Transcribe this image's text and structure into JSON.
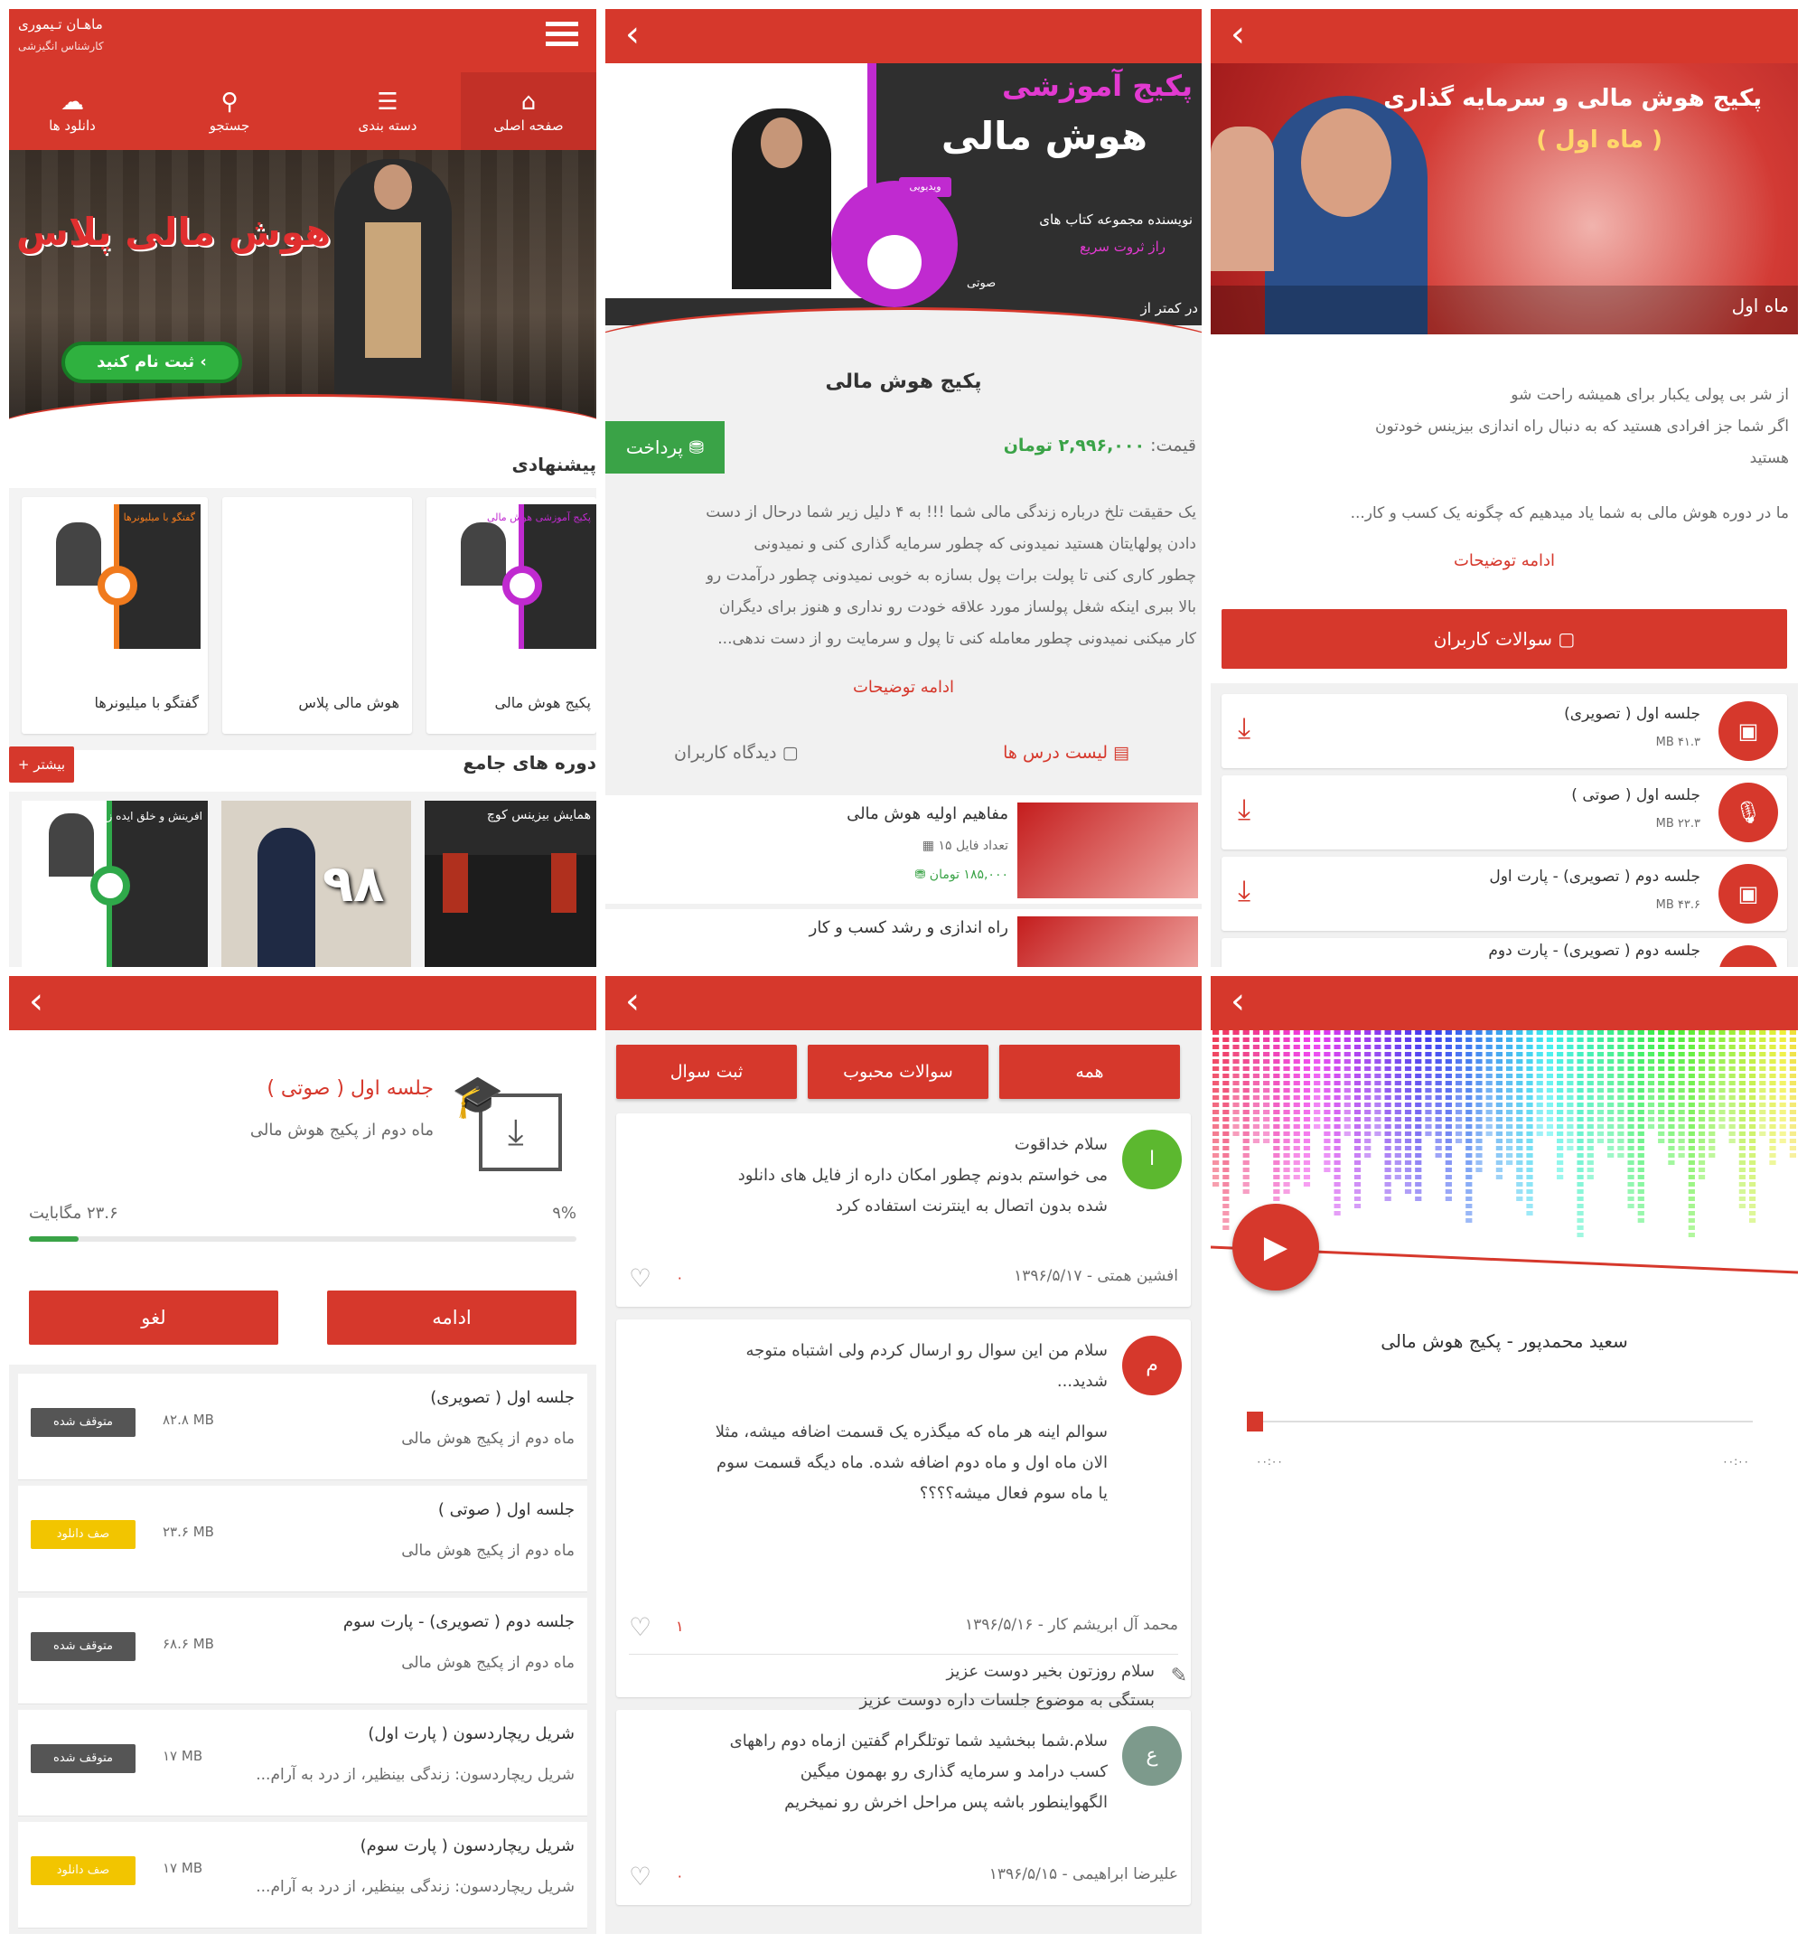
{
  "app": {
    "brand_title": "ماهـان تـیموری",
    "brand_subtitle": "کارشناس انگیزشی",
    "nav": [
      {
        "label": "صفحه اصلی",
        "icon": "home-icon"
      },
      {
        "label": "دسته بندی",
        "icon": "list-icon"
      },
      {
        "label": "جستجو",
        "icon": "search-icon"
      },
      {
        "label": "دانلود ها",
        "icon": "cloud-download-icon"
      }
    ],
    "hero_text": "هوش مالی پلاس",
    "hero_button": "ثبت نام کنید",
    "suggested_title": "پیشنهادی",
    "suggested": [
      {
        "label": "پکیج هوش مالی"
      },
      {
        "label": "هوش مالی پلاس"
      },
      {
        "label": "گفتگو با میلیونرها"
      }
    ],
    "thumb_text_1": "پکیج آموزشی هوش مالی",
    "thumb_text_2": "گفتگو با میلیونرها",
    "thumb_text_3": "همایش بیزینس کوچ",
    "thumb_text_4": "۹۸",
    "thumb_text_5": "افرینش و خلق ایده زیبا",
    "full_courses_title": "دوره های جامع",
    "more_label": "بیشتر"
  },
  "detail": {
    "banner_line1": "پکیج آموزشی",
    "banner_line2": "هوش مالی",
    "banner_line3": "نویسنده مجموعه کتاب های",
    "banner_line4": "راز ثروت سریع",
    "banner_tag": "صوتی",
    "banner_tag2": "ویدیویی",
    "banner_bottom": "در کمتر از",
    "title": "پکیج هوش مالی",
    "price_label": "قیمت:",
    "price_value": "۲,۹۹۶,۰۰۰ تومان",
    "pay_button": "پرداخت",
    "description": [
      "یک حقیقت تلخ درباره زندگی مالی شما !!! به ۴ دلیل زیر شما درحال از دست",
      "دادن پولهایتان هستید نمیدونی که چطور سرمایه گذاری کنی و نمیدونی",
      "چطور کاری کنی تا پولت برات پول بسازه به خوبی نمیدونی چطور درآمدت رو",
      "بالا ببری اینکه شغل پولساز مورد علاقه خودت رو نداری و هنوز برای دیگران",
      "کار میکنی نمیدونی چطور معامله کنی تا پول و سرمایت رو از دست ندهی..."
    ],
    "more_link": "ادامه توضیحات",
    "tab_lessons": "لیست درس ها",
    "tab_reviews": "دیدگاه کاربران",
    "lessons": [
      {
        "title": "مفاهیم اولیه هوش مالی",
        "files": "تعداد فایل ۱۵",
        "price": "۱۸۵,۰۰۰ تومان"
      },
      {
        "title": "راه اندازی و رشد کسب و کار",
        "files": "",
        "price": ""
      }
    ]
  },
  "month": {
    "banner_title": "پکیج هوش مالی و سرمایه گذاری",
    "banner_sub": "( ماه اول )",
    "banner_footer": "ماه اول",
    "desc": [
      "از شر بی پولی یکبار برای همیشه راحت شو",
      "اگر شما جز افرادی هستید که به دنبال راه اندازی بیزینس خودتون",
      "هستید",
      "ما در دوره هوش مالی به شما یاد میدهیم که چگونه یک کسب و کار..."
    ],
    "more_link": "ادامه توضیحات",
    "questions_button": "سوالات کاربران",
    "files": [
      {
        "title": "جلسه اول ( تصویری)",
        "size": "۴۱.۳ MB",
        "icon": "video-icon"
      },
      {
        "title": "جلسه اول ( صوتی )",
        "size": "۲۲.۳ MB",
        "icon": "microphone-icon"
      },
      {
        "title": "جلسه دوم ( تصویری) - پارت اول",
        "size": "۴۳.۶ MB",
        "icon": "video-icon"
      },
      {
        "title": "جلسه دوم ( تصویری) - پارت دوم",
        "size": "",
        "icon": "video-icon"
      }
    ]
  },
  "downloads": {
    "current_title": "جلسه اول ( صوتی )",
    "current_sub": "ماه دوم از پکیج هوش مالی",
    "current_size": "۲۳.۶ مگابایت",
    "current_percent": "۹%",
    "current_progress": 0.09,
    "continue_button": "ادامه",
    "cancel_button": "لغو",
    "items": [
      {
        "title": "جلسه اول ( تصویری)",
        "sub": "ماه دوم از پکیج هوش مالی",
        "size": "۸۲.۸ MB",
        "status": "متوقف شده",
        "status_color": "#555555"
      },
      {
        "title": "جلسه اول ( صوتی )",
        "sub": "ماه دوم از پکیج هوش مالی",
        "size": "۲۳.۶ MB",
        "status": "صف دانلود",
        "status_color": "#f2c500"
      },
      {
        "title": "جلسه دوم ( تصویری) - پارت سوم",
        "sub": "ماه دوم از پکیج هوش مالی",
        "size": "۶۸.۶ MB",
        "status": "متوقف شده",
        "status_color": "#555555"
      },
      {
        "title": "شریل ریچاردسون ( پارت اول)",
        "sub": "شریل ریچاردسون: زندگی بینظیر، از درد به آرام...",
        "size": "۱۷ MB",
        "status": "متوقف شده",
        "status_color": "#555555"
      },
      {
        "title": "شریل ریچاردسون ( پارت سوم)",
        "sub": "شریل ریچاردسون: زندگی بینظیر، از درد به آرام...",
        "size": "۱۷ MB",
        "status": "صف دانلود",
        "status_color": "#f2c500"
      }
    ]
  },
  "questions": {
    "tabs": [
      "همه",
      "سوالات محبوب",
      "ثبت سوال"
    ],
    "posts": [
      {
        "avatar": "ا",
        "avatar_color": "#5cb82f",
        "lines": [
          "سلام خداقوت",
          "می خواستم بدونم چطور امکان داره از فایل های دانلود",
          "شده بدون اتصال به اینترنت استفاده کرد"
        ],
        "author": "افشین همتی - ۱۳۹۶/۵/۱۷",
        "likes": "۰"
      },
      {
        "avatar": "م",
        "avatar_color": "#d6382c",
        "lines": [
          "سلام من این سوال رو ارسال کردم ولی اشتباه متوجه",
          "شدید...",
          "سوالم اینه هر ماه که میگذره یک قسمت اضافه میشه، مثلا",
          "الان ماه اول و ماه دوم اضافه شده. ماه دیگه قسمت سوم",
          "یا ماه سوم فعال میشه؟؟؟؟"
        ],
        "author": "محمد آل ابریشم کار - ۱۳۹۶/۵/۱۶",
        "likes": "۱",
        "reply": [
          "سلام روزتون بخیر دوست عزیز",
          "بستگی به موضوع جلسات داره دوست عزیز"
        ]
      },
      {
        "avatar": "ع",
        "avatar_color": "#7d9a8c",
        "lines": [
          "سلام.شما ببخشید شما توتلگرام گفتین ازماه دوم راههای",
          "کسب درامد و سرمایه گذاری رو بهمون میگین",
          "الگهواینطور باشه پس مراحل اخرش رو نمیخریم"
        ],
        "author": "علیرضا ابراهیمی - ۱۳۹۶/۵/۱۵",
        "likes": "۰"
      }
    ]
  },
  "player": {
    "track": "سعید محمدپور - پکیج هوش مالی",
    "time_start": "۰۰:۰۰",
    "time_end": "۰۰:۰۰",
    "progress": 0.0
  },
  "colors": {
    "accent": "#d6382c",
    "green": "#3aa347"
  }
}
